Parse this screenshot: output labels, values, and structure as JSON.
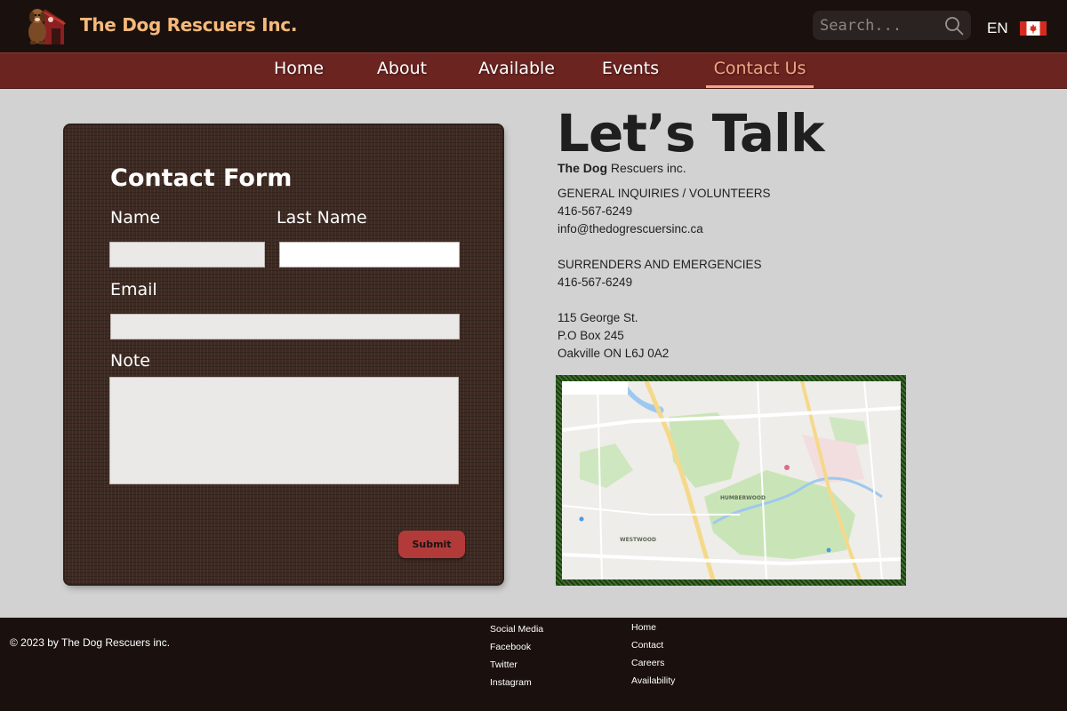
{
  "header": {
    "brand": "The Dog Rescuers Inc.",
    "search_placeholder": "Search...",
    "language": "EN"
  },
  "nav": {
    "items": [
      {
        "label": "Home"
      },
      {
        "label": "About"
      },
      {
        "label": "Available"
      },
      {
        "label": "Events"
      },
      {
        "label": "Contact Us",
        "active": true
      }
    ]
  },
  "form": {
    "title": "Contact Form",
    "name_label": "Name",
    "last_name_label": "Last Name",
    "email_label": "Email",
    "note_label": "Note",
    "submit_label": "Submit"
  },
  "contact": {
    "heading": "Let’s Talk",
    "org_bold": "The Dog",
    "org_rest": " Rescuers inc.",
    "general_title": "GENERAL INQUIRIES / VOLUNTEERS",
    "general_phone": "416-567-6249",
    "general_email": "info@thedogrescuersinc.ca",
    "surrender_title": "SURRENDERS AND EMERGENCIES",
    "surrender_phone": "416-567-6249",
    "address_line1": "115 George St.",
    "address_line2": "P.O Box 245",
    "address_line3": "Oakville ON L6J 0A2"
  },
  "map": {
    "label_humberwood": "HUMBERWOOD",
    "label_westwood": "WESTWOOD"
  },
  "footer": {
    "copyright": "© 2023 by The Dog Rescuers inc.",
    "social_title": "Social Media",
    "social_links": [
      "Facebook",
      "Twitter",
      "Instagram"
    ],
    "site_links": [
      "Home",
      "Contact",
      "Careers",
      "Availability"
    ]
  },
  "colors": {
    "topbar": "#1a110e",
    "navbar": "#6b2420",
    "brand": "#f6b97a",
    "active_nav": "#f2a585",
    "submit": "#b23b3a"
  }
}
